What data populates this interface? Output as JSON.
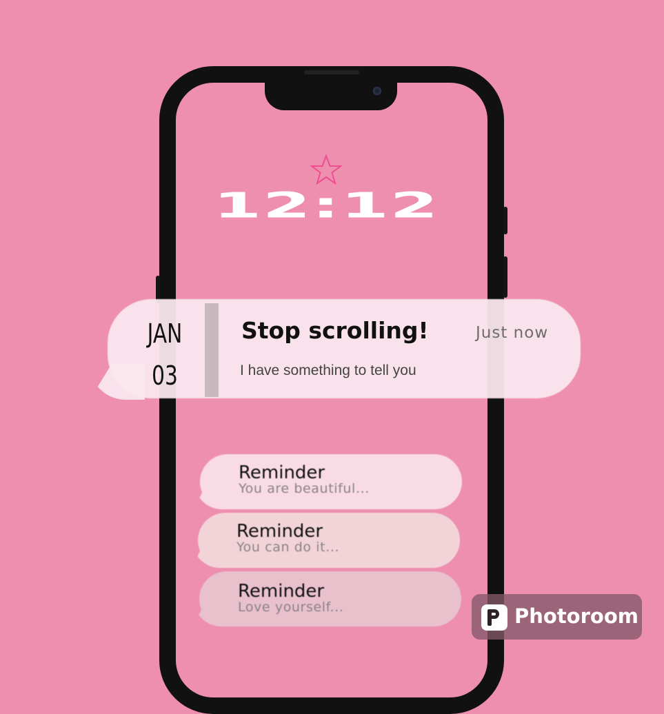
{
  "lockscreen": {
    "time": "12:12",
    "date": {
      "month": "JAN",
      "day": "03"
    }
  },
  "notification": {
    "title": "Stop scrolling!",
    "timestamp": "Just now",
    "body": "I have something to tell you"
  },
  "reminders": [
    {
      "title": "Reminder",
      "body": "You are beautiful..."
    },
    {
      "title": "Reminder",
      "body": "You can do it..."
    },
    {
      "title": "Reminder",
      "body": "Love yourself..."
    }
  ],
  "watermark": {
    "label": "Photoroom",
    "icon": "photoroom-logo-icon"
  },
  "icons": {
    "decoration": "star-icon"
  },
  "colors": {
    "background": "#ef8fb0",
    "clock": "#ffffff",
    "star_outline": "#ee4d8f"
  }
}
